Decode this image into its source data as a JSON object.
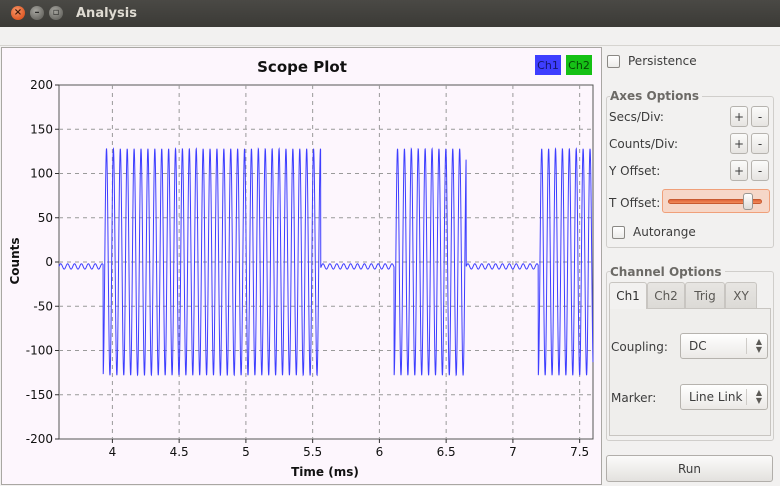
{
  "window": {
    "title": "Analysis"
  },
  "plot": {
    "legend": [
      {
        "label": "Ch1",
        "color": "#3e3eff"
      },
      {
        "label": "Ch2",
        "color": "#16c016"
      }
    ]
  },
  "chart_data": {
    "type": "line",
    "title": "Scope Plot",
    "xlabel": "Time (ms)",
    "ylabel": "Counts",
    "xlim": [
      3.6,
      7.6
    ],
    "ylim": [
      -200,
      200
    ],
    "x_ticks": [
      "4",
      "4.5",
      "5",
      "5.5",
      "6",
      "6.5",
      "7",
      "7.5"
    ],
    "y_ticks": [
      "200",
      "150",
      "100",
      "50",
      "0",
      "-50",
      "-100",
      "-150",
      "-200"
    ],
    "grid": true,
    "series": [
      {
        "name": "Ch1",
        "color": "#3e3eff",
        "description_bursts": [
          {
            "start": 3.93,
            "end": 5.56,
            "amplitude": 128
          },
          {
            "start": 6.11,
            "end": 6.65,
            "amplitude": 128
          },
          {
            "start": 7.19,
            "end": 7.6,
            "amplitude": 128
          }
        ],
        "idle_level": -5
      }
    ]
  },
  "panel": {
    "persistence_label": "Persistence",
    "axes_options_title": "Axes Options",
    "secs_div_label": "Secs/Div:",
    "counts_div_label": "Counts/Div:",
    "y_offset_label": "Y Offset:",
    "t_offset_label": "T Offset:",
    "t_offset_value": 0.88,
    "plus_label": "+",
    "minus_label": "-",
    "autorange_label": "Autorange",
    "channel_options_title": "Channel Options",
    "tabs": [
      "Ch1",
      "Ch2",
      "Trig",
      "XY"
    ],
    "coupling_label": "Coupling:",
    "coupling_value": "DC",
    "marker_label": "Marker:",
    "marker_value": "Line Link",
    "run_label": "Run"
  }
}
